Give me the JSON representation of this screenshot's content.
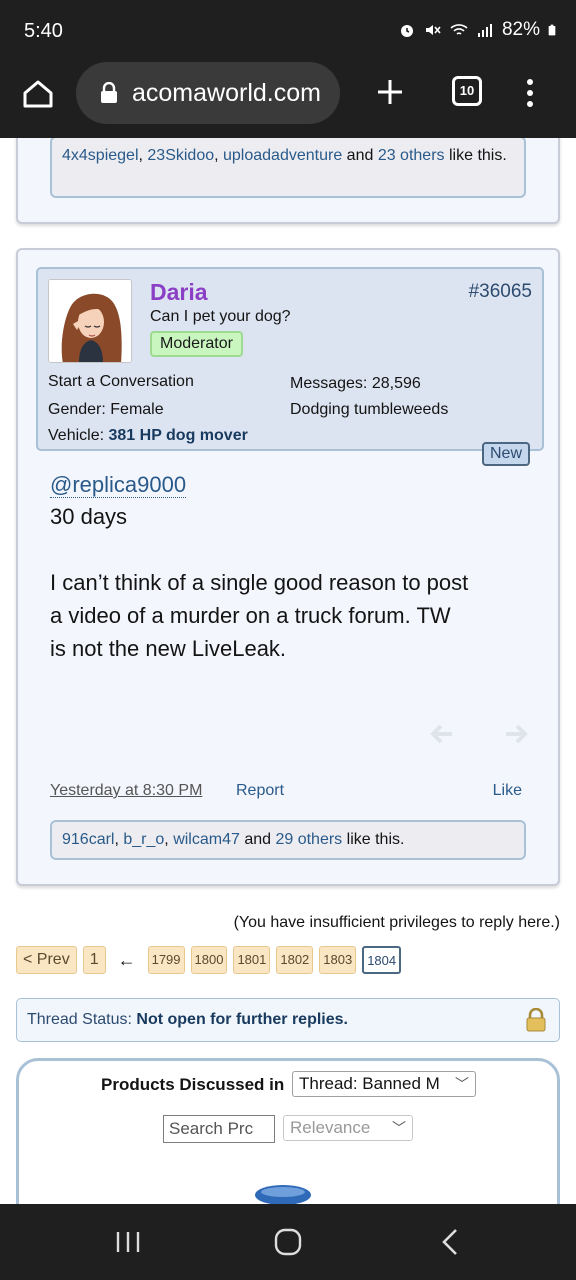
{
  "status_bar": {
    "time": "5:40",
    "battery": "82%"
  },
  "browser": {
    "url": "acomaworld.com",
    "tab_count": "10"
  },
  "prev_post": {
    "likers": [
      "4x4spiegel",
      "23Skidoo",
      "uploadadventure"
    ],
    "others": "23 others",
    "suffix": "like this."
  },
  "post": {
    "username": "Daria",
    "user_title": "Can I pet your dog?",
    "role_badge": "Moderator",
    "post_number": "#36065",
    "start_conversation": "Start a Conversation",
    "gender_label": "Gender:",
    "gender_value": "Female",
    "vehicle_label": "Vehicle:",
    "vehicle_value": "381 HP dog mover",
    "messages_label": "Messages:",
    "messages_value": "28,596",
    "location": "Dodging tumbleweeds",
    "new_badge": "New",
    "mention": "@replica9000",
    "line1": "30 days",
    "body": "I can’t think of a single good reason to post a video of a murder on a truck forum. TW is not the new LiveLeak.",
    "timestamp": "Yesterday at 8:30 PM",
    "report": "Report",
    "like": "Like",
    "likers": [
      "916carl",
      "b_r_o",
      "wilcam47"
    ],
    "others": "29 others",
    "suffix": "like this."
  },
  "no_reply_notice": "(You have insufficient privileges to reply here.)",
  "pagination": {
    "prev": "< Prev",
    "first": "1",
    "pages": [
      "1799",
      "1800",
      "1801",
      "1802",
      "1803"
    ],
    "current": "1804"
  },
  "thread_status": {
    "label": "Thread Status:",
    "value": "Not open for further replies."
  },
  "products": {
    "title": "Products Discussed in",
    "scope_select": "Thread: Banned M",
    "search_placeholder": "Search Prc",
    "sort_select": "Relevance"
  },
  "colors": {
    "username": "#8b3fc4",
    "link": "#2a5a8a",
    "moderator_badge": "#c9f5bf",
    "page_button": "#fbe6c3"
  }
}
